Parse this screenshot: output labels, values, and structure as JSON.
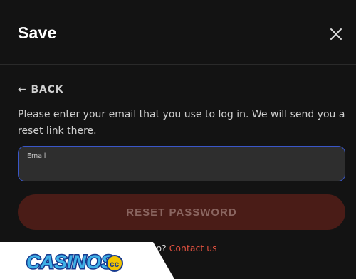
{
  "header": {
    "title": "Save"
  },
  "back": {
    "label": "BACK"
  },
  "form": {
    "description": "Please enter your email that you use to log in. We will send you a reset link there.",
    "email_label": "Email",
    "email_value": "",
    "submit_label": "RESET PASSWORD"
  },
  "help": {
    "prefix": "help?",
    "link": "Contact us"
  },
  "watermark": {
    "text": "CASINOS.cc"
  },
  "colors": {
    "background": "#131313",
    "focus_border": "#3a57c8",
    "button_bg": "#4a1c17",
    "link": "#e0513f"
  },
  "icons": {
    "close": "close-icon",
    "back": "arrow-left-icon"
  }
}
